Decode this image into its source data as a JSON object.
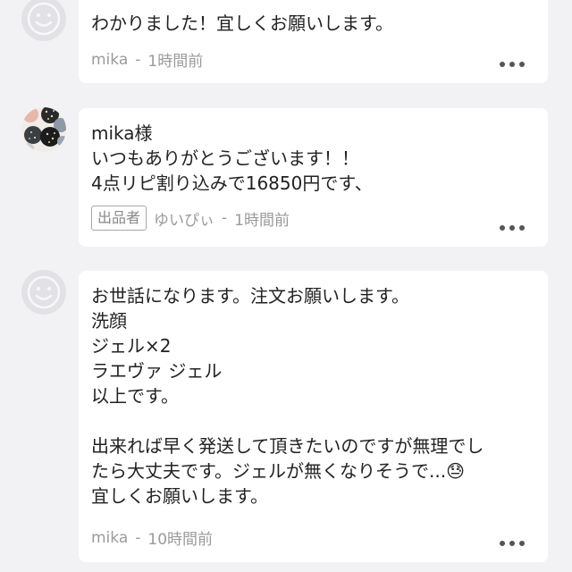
{
  "comments": [
    {
      "text": "わかりました！宜しくお願いします。",
      "author": "mika",
      "separator": "-",
      "time": "1時間前"
    },
    {
      "text": "mika様\nいつもありがとうございます！！\n4点リピ割り込みで16850円です、",
      "badge": "出品者",
      "author": "ゆいぴぃ",
      "separator": "-",
      "time": "1時間前"
    },
    {
      "text": "お世話になります。注文お願いします。\n洗顔\nジェル×2\nラエヴァ ジェル\n以上です。\n\n出来れば早く発送して頂きたいのですが無理でし\nたら大丈夫です。ジェルが無くなりそうで...😓\n宜しくお願いします。",
      "author": "mika",
      "separator": "-",
      "time": "10時間前"
    }
  ],
  "icons": {
    "default_avatar": "smiley-avatar-icon",
    "seller_avatar": "patterned-avatar-icon",
    "more": "more-dots-icon"
  }
}
